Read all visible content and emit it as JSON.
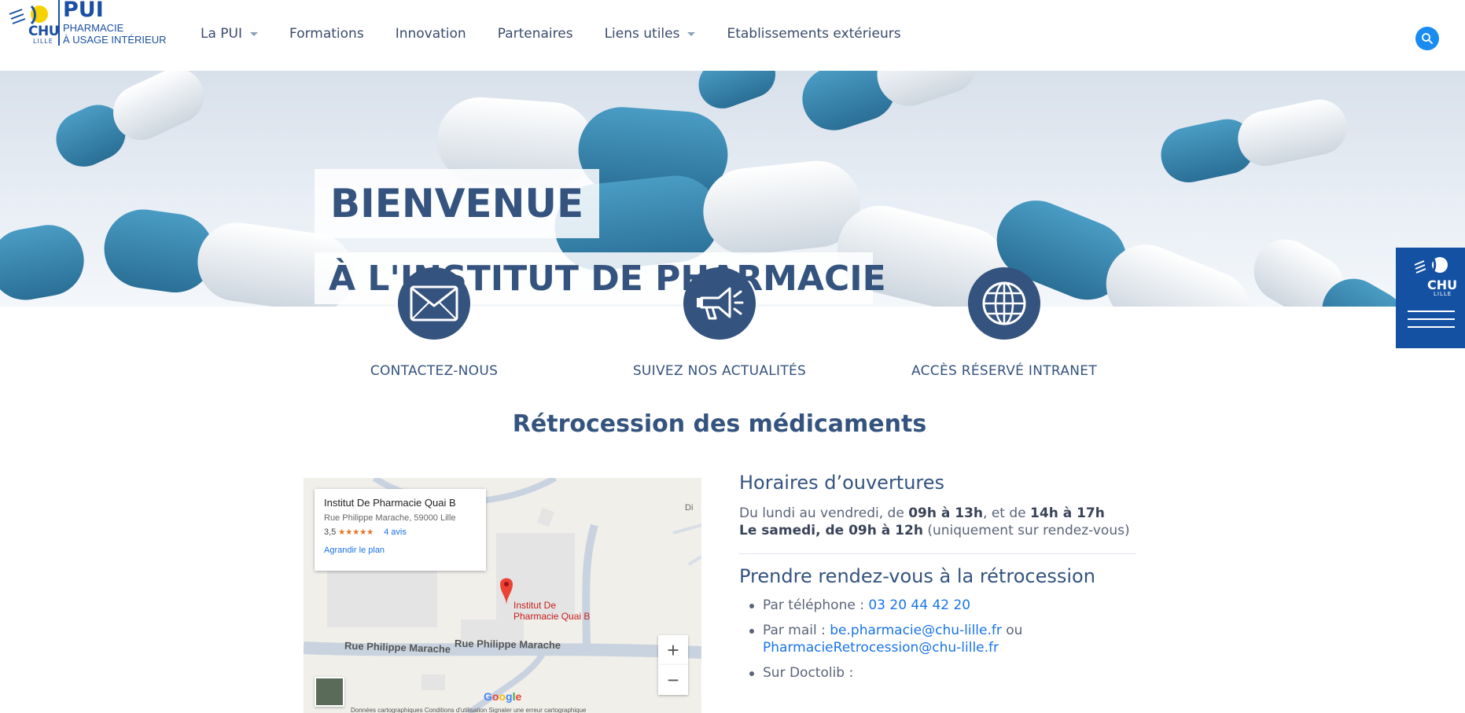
{
  "header": {
    "logo": {
      "brand": "CHU",
      "city": "LILLE",
      "title": "PUI",
      "subtitle_line1": "PHARMACIE",
      "subtitle_line2": "À USAGE INTÉRIEUR"
    },
    "nav": [
      {
        "label": "La PUI",
        "has_dropdown": true
      },
      {
        "label": "Formations",
        "has_dropdown": false
      },
      {
        "label": "Innovation",
        "has_dropdown": false
      },
      {
        "label": "Partenaires",
        "has_dropdown": false
      },
      {
        "label": "Liens utiles",
        "has_dropdown": true
      },
      {
        "label": "Etablissements extérieurs",
        "has_dropdown": false
      }
    ],
    "search_icon": "search-icon",
    "accent": "#1a8cf0"
  },
  "hero": {
    "title_line1": "BIENVENUE",
    "title_line2": "À L'INSTITUT DE PHARMACIE"
  },
  "quick_links": [
    {
      "icon": "envelope-icon",
      "label": "CONTACTEZ-NOUS"
    },
    {
      "icon": "megaphone-icon",
      "label": "SUIVEZ NOS ACTUALITÉS"
    },
    {
      "icon": "globe-icon",
      "label": "ACCÈS RÉSERVÉ INTRANET"
    }
  ],
  "side_tab": {
    "brand": "CHU",
    "city": "LILLE",
    "icon": "menu-icon",
    "color": "#1451a3"
  },
  "section": {
    "title": "Rétrocession des médicaments"
  },
  "map": {
    "place_name": "Institut De Pharmacie Quai B",
    "address": "Rue Philippe Marache, 59000 Lille",
    "rating": "3,5",
    "stars": "★★★★★",
    "reviews": "4 avis",
    "enlarge_link": "Agrandir le plan",
    "pin_label_line1": "Institut De",
    "pin_label_line2": "Pharmacie Quai B",
    "street_label": "Rue Philippe Marache",
    "corner_label": "Di",
    "zoom_in": "+",
    "zoom_out": "−",
    "footer_text": "Données cartographiques    Conditions d'utilisation    Signaler une erreur cartographique"
  },
  "info": {
    "hours_heading": "Horaires d’ouvertures",
    "hours_weekday_prefix": "Du lundi au vendredi, de ",
    "hours_weekday_morning": "09h à 13h",
    "hours_weekday_middle": ", et de ",
    "hours_weekday_afternoon": "14h à 17h",
    "hours_saturday": "Le samedi, de 09h à 12h",
    "hours_saturday_note": " (uniquement sur rendez-vous)",
    "rdv_heading": "Prendre rendez-vous à la rétrocession",
    "phone_label": "Par téléphone : ",
    "phone": "03 20 44 42 20",
    "mail_label": "Par mail : ",
    "mail1": "be.pharmacie@chu-lille.fr",
    "mail_or": " ou",
    "mail2": "PharmacieRetrocession@chu-lille.fr",
    "doctolib_label": "Sur Doctolib :"
  }
}
